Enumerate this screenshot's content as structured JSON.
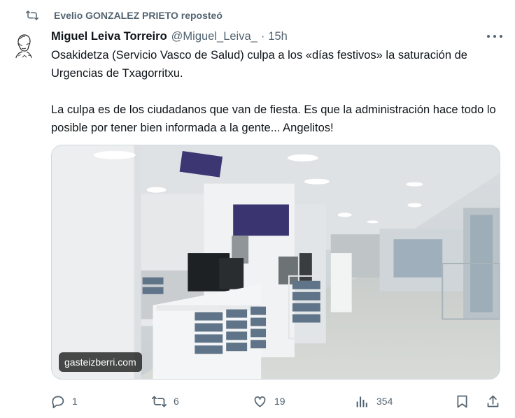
{
  "repost": {
    "label": "Evelio GONZALEZ PRIETO reposteó",
    "icon": "repost-icon"
  },
  "tweet": {
    "author_name": "Miguel Leiva Torreiro",
    "handle": "@Miguel_Leiva_",
    "separator": "·",
    "time": "15h",
    "paragraphs": [
      "Osakidetza (Servicio Vasco de Salud) culpa a los «días festivos» la saturación de Urgencias de Txagorritxu.",
      "La culpa es de los ciudadanos que van de fiesta. Es que la administración hace todo lo posible por tener bien informada a la gente... Angelitos!"
    ],
    "media_watermark": "gasteizberri.com"
  },
  "actions": {
    "replies": "1",
    "reposts": "6",
    "likes": "19",
    "views": "354"
  },
  "icons": [
    "repost-icon",
    "avatar",
    "more-icon",
    "reply-icon",
    "repost-icon",
    "like-icon",
    "views-icon",
    "bookmark-icon",
    "share-icon"
  ],
  "colors": {
    "text": "#0f1419",
    "secondary": "#536471",
    "border": "#cfd9de"
  }
}
